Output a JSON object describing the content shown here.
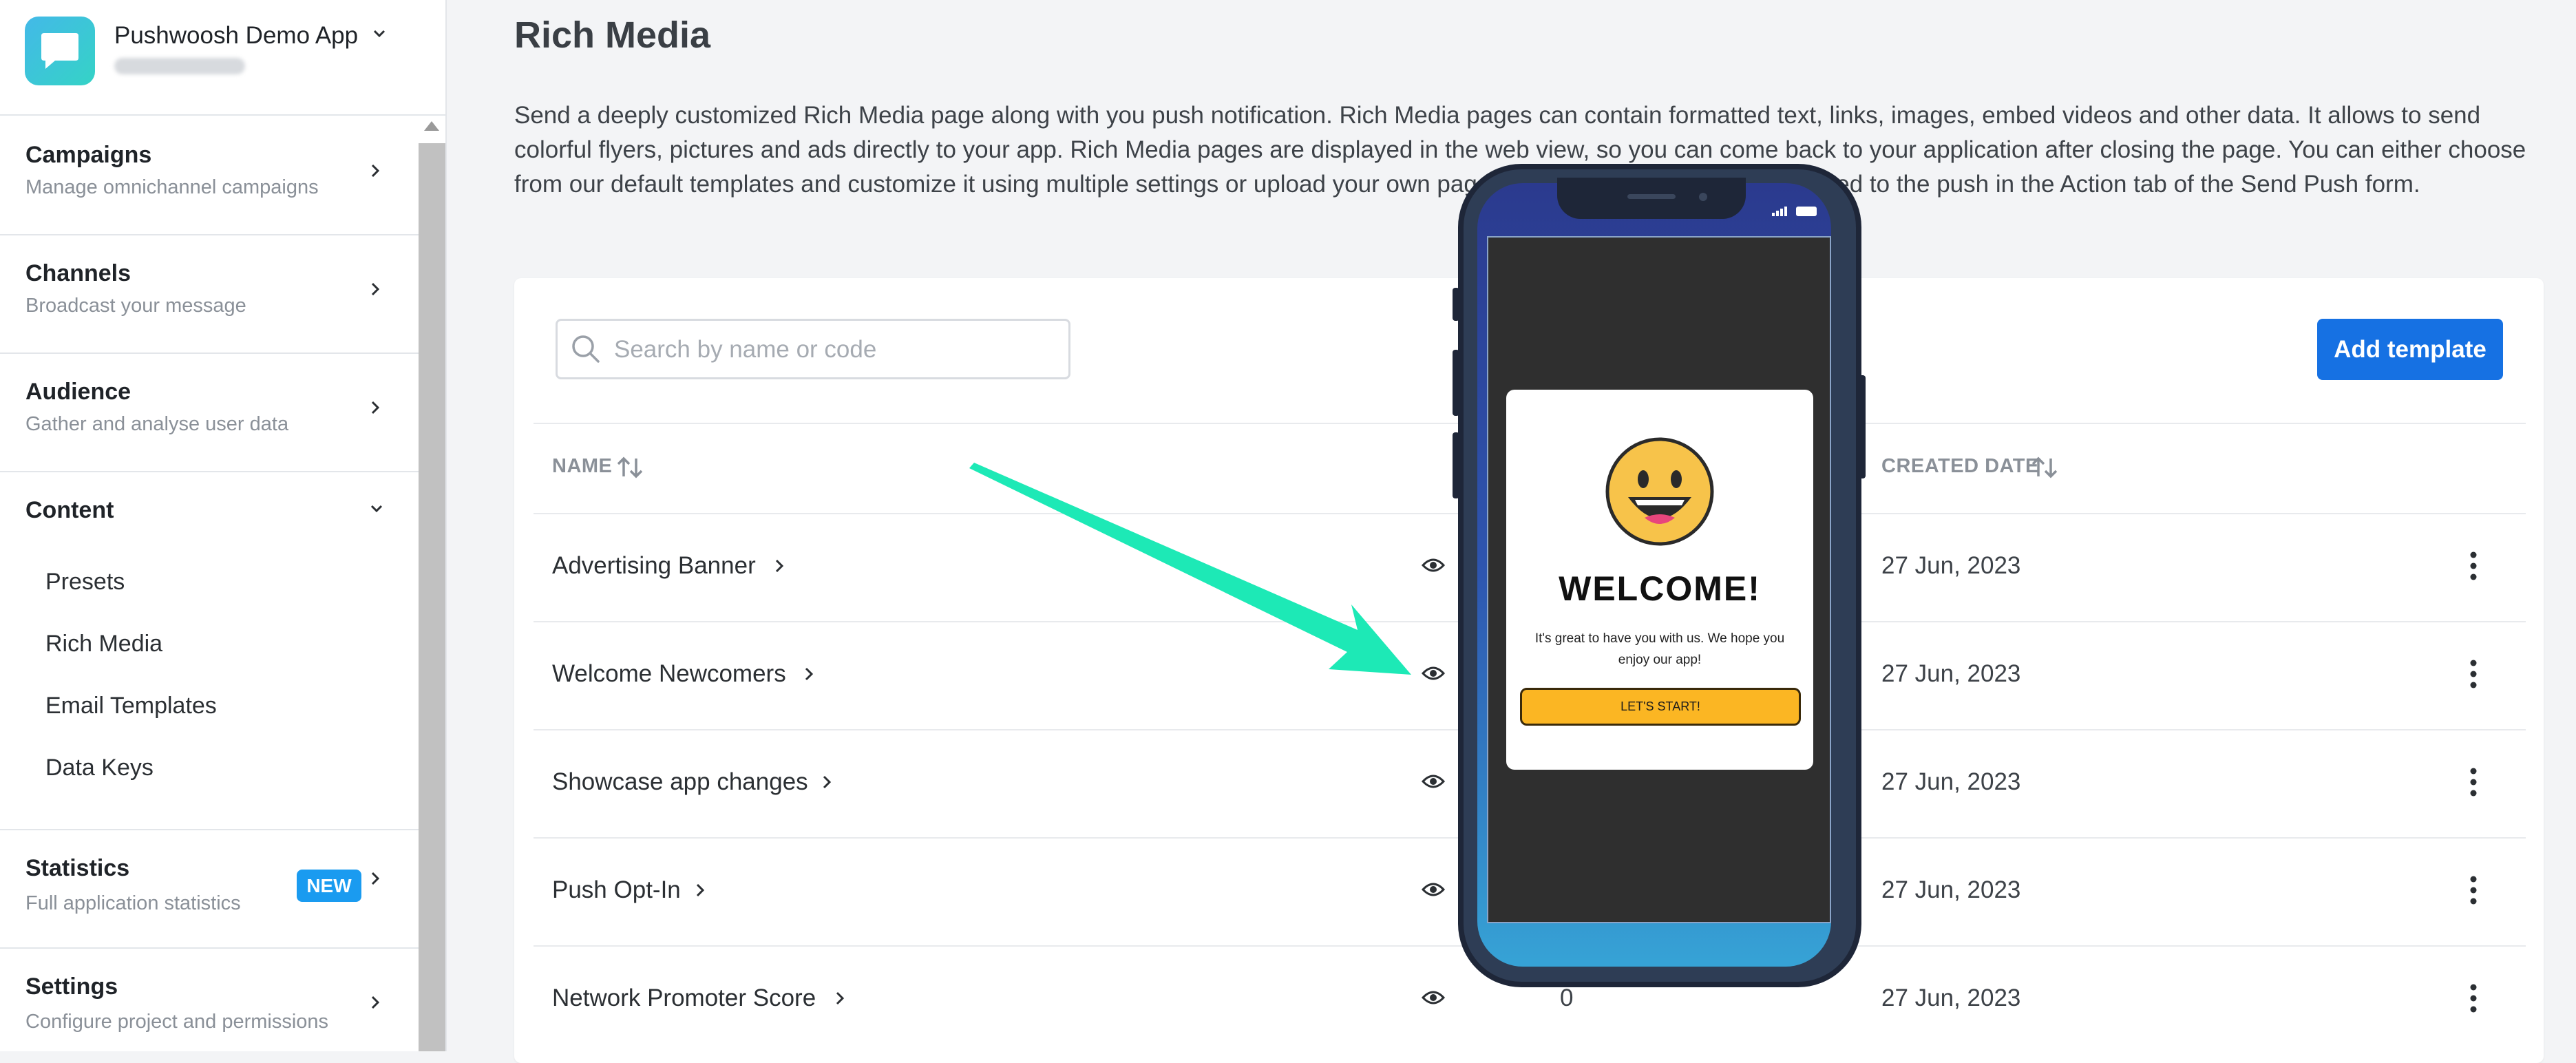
{
  "app": {
    "name": "Pushwoosh Demo App"
  },
  "sidebar": {
    "sections": [
      {
        "title": "Campaigns",
        "subtitle": "Manage omnichannel campaigns"
      },
      {
        "title": "Channels",
        "subtitle": "Broadcast your message"
      },
      {
        "title": "Audience",
        "subtitle": "Gather and analyse user data"
      },
      {
        "title": "Content",
        "subtitle": ""
      },
      {
        "title": "Statistics",
        "subtitle": "Full application statistics",
        "badge": "NEW"
      },
      {
        "title": "Settings",
        "subtitle": "Configure project and permissions"
      }
    ],
    "content_items": [
      "Presets",
      "Rich Media",
      "Email Templates",
      "Data Keys"
    ]
  },
  "page": {
    "title": "Rich Media",
    "description": "Send a deeply customized Rich Media page along with you push notification. Rich Media pages can contain formatted text, links, images, embed videos and other data. It allows to send colorful flyers, pictures and ads directly to your app. Rich Media pages are displayed in the web view, so you can come back to your application after closing the page. You can either choose from our default templates and customize it using multiple settings or upload your own page. Rich Media page can be attached to the push in the Action tab of the Send Push form."
  },
  "toolbar": {
    "search_placeholder": "Search by name or code",
    "add_button": "Add template"
  },
  "table": {
    "headers": {
      "name": "NAME",
      "created": "CREATED DATE"
    },
    "rows": [
      {
        "name": "Advertising Banner",
        "date": "27 Jun, 2023"
      },
      {
        "name": "Welcome Newcomers",
        "date": "27 Jun, 2023"
      },
      {
        "name": "Showcase app changes",
        "date": "27 Jun, 2023"
      },
      {
        "name": "Push Opt-In",
        "date": "27 Jun, 2023"
      },
      {
        "name": "Network Promoter Score",
        "count": "0",
        "date": "27 Jun, 2023"
      }
    ]
  },
  "preview": {
    "title": "WELCOME!",
    "text": "It's great to have you with us. We hope you enjoy our app!",
    "button": "LET'S START!"
  },
  "colors": {
    "accent": "#1671e3",
    "badge": "#1a9bf0",
    "arrow": "#1de9b6",
    "logo": "#35d3c6",
    "preview_button": "#fbb623"
  }
}
